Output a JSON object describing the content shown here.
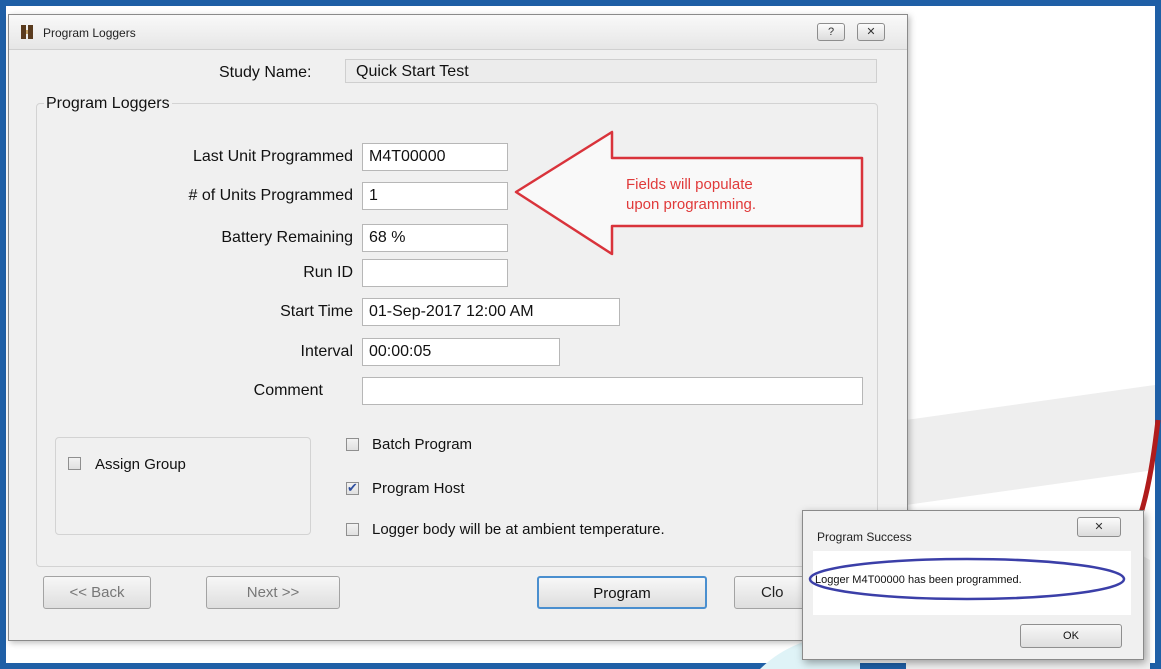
{
  "window": {
    "title": "Program Loggers",
    "help_glyph": "?",
    "close_glyph": "✕"
  },
  "study": {
    "label": "Study Name:",
    "value": "Quick Start Test"
  },
  "group_title": "Program Loggers",
  "fields": {
    "last_unit": {
      "label": "Last Unit Programmed",
      "value": "M4T00000"
    },
    "units_programmed": {
      "label": "# of Units Programmed",
      "value": "1"
    },
    "battery": {
      "label": "Battery Remaining",
      "value": "68 %"
    },
    "run_id": {
      "label": "Run ID",
      "value": ""
    },
    "start_time": {
      "label": "Start Time",
      "value": "01-Sep-2017 12:00 AM"
    },
    "interval": {
      "label": "Interval",
      "value": "00:00:05"
    },
    "comment": {
      "label": "Comment",
      "value": ""
    }
  },
  "checkboxes": {
    "assign_group": {
      "label": "Assign Group",
      "checked": false
    },
    "batch_program": {
      "label": "Batch Program",
      "checked": false
    },
    "program_host": {
      "label": "Program Host",
      "checked": true
    },
    "ambient": {
      "label": "Logger body will be at ambient temperature.",
      "checked": false
    }
  },
  "buttons": {
    "back": "<< Back",
    "next": "Next >>",
    "program": "Program",
    "close": "Clo"
  },
  "annotation": {
    "line1": "Fields will populate",
    "line2": "upon programming."
  },
  "popup": {
    "title": "Program Success",
    "message": "Logger M4T00000 has been programmed.",
    "ok": "OK",
    "close_glyph": "✕"
  },
  "colors": {
    "frame": "#1f5fa6",
    "annotation": "#e03a3a",
    "highlight_oval": "#3b3fa8",
    "primary_button_border": "#4a8fcf"
  }
}
